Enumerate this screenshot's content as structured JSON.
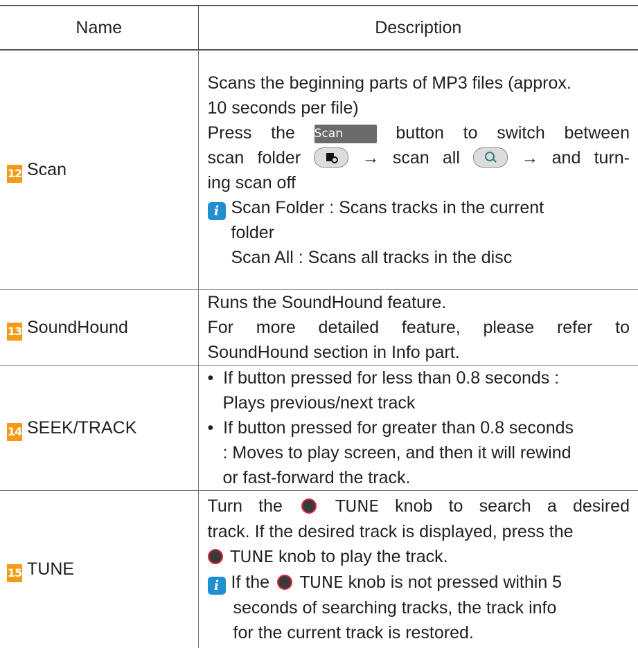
{
  "table": {
    "header": {
      "name": "Name",
      "description": "Description"
    },
    "rows": [
      {
        "number": "12",
        "name": "Scan",
        "lines": [
          "Scans the beginning parts of MP3 files (approx.",
          "10 seconds per file)"
        ],
        "press_pre": "Press the",
        "button_label": "Scan",
        "press_post": "button to switch between",
        "scan_folder_pre": "scan folder",
        "arrow1": "→",
        "scan_all_pre": "scan all",
        "arrow2": "→",
        "and_turn": "and turn-",
        "turn_off": "ing scan off",
        "note_line1": "Scan Folder : Scans tracks in the current",
        "note_line2": "folder",
        "note_line3": "Scan All : Scans all tracks in the disc",
        "icons": {
          "folder": "scan-folder-icon",
          "all": "scan-all-icon",
          "info": "info-icon"
        }
      },
      {
        "number": "13",
        "name": "SoundHound",
        "line1": "Runs the SoundHound feature.",
        "line2": "For more detailed feature, please refer to",
        "line3": "SoundHound section in Info part."
      },
      {
        "number": "14",
        "name": "SEEK/TRACK",
        "b1_line1": "If button pressed for less than 0.8 seconds :",
        "b1_line2": "Plays previous/next track",
        "b2_line1": "If button pressed for greater than 0.8 seconds",
        "b2_line2": ": Moves to play screen, and then it will rewind",
        "b2_line3": "or fast-forward the track."
      },
      {
        "number": "15",
        "name": "TUNE",
        "l1_pre": "Turn the",
        "l1_tune": "TUNE",
        "l1_post": "knob to search a desired",
        "l2": "track. If the desired track is displayed, press the",
        "l3_tune": "TUNE",
        "l3_post": "knob to play the track.",
        "n1_pre": "If the",
        "n1_tune": "TUNE",
        "n1_post": "knob is not pressed within 5",
        "n2": "seconds of searching tracks, the track info",
        "n3": "for the current track is restored.",
        "knob_icon": "tune-knob-icon"
      }
    ]
  },
  "colors": {
    "number_badge": "#f39a16",
    "info_badge": "#1f8fd1",
    "knob_ring": "#e3263a",
    "scan_button": "#6b6b6b"
  }
}
